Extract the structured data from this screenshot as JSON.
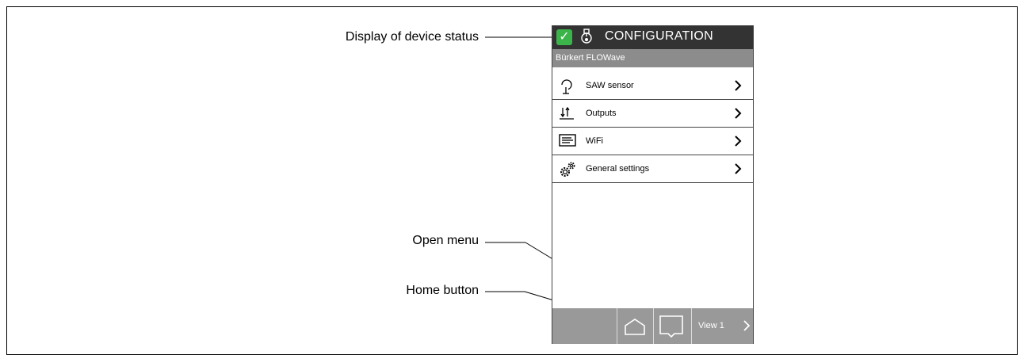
{
  "callouts": {
    "device_status": "Display of device status",
    "open_menu": "Open menu",
    "home_button": "Home button"
  },
  "screen": {
    "title": "CONFIGURATION",
    "device_name": "Bürkert FLOWave",
    "status": "ok",
    "menu_items": [
      {
        "label": "SAW sensor",
        "icon": "saw-sensor-icon"
      },
      {
        "label": "Outputs",
        "icon": "outputs-icon"
      },
      {
        "label": "WiFi",
        "icon": "wifi-icon"
      },
      {
        "label": "General settings",
        "icon": "gears-icon"
      }
    ],
    "bottom_bar": {
      "view_label": "View 1"
    }
  },
  "colors": {
    "titlebar": "#333333",
    "subbar": "#8c8c8c",
    "status_ok": "#3bb44a",
    "bottombar": "#999999"
  }
}
